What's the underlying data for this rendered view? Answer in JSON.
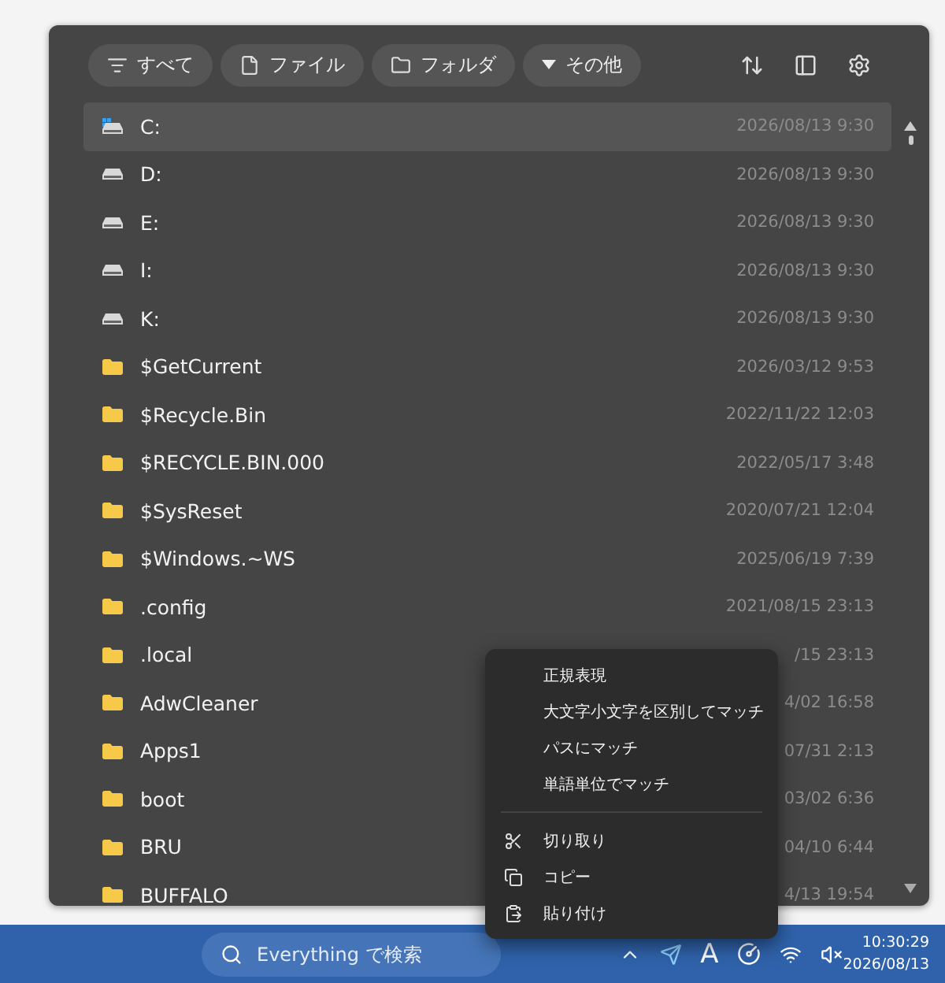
{
  "filters": [
    {
      "label": "すべて",
      "kind": "all"
    },
    {
      "label": "ファイル",
      "kind": "file"
    },
    {
      "label": "フォルダ",
      "kind": "folder"
    },
    {
      "label": "その他",
      "kind": "more"
    }
  ],
  "rows": [
    {
      "kind": "system_drive",
      "name": "C:",
      "date": "2026/08/13 9:30",
      "selected": true
    },
    {
      "kind": "drive",
      "name": "D:",
      "date": "2026/08/13 9:30",
      "selected": false
    },
    {
      "kind": "drive",
      "name": "E:",
      "date": "2026/08/13 9:30",
      "selected": false
    },
    {
      "kind": "drive",
      "name": "I:",
      "date": "2026/08/13 9:30",
      "selected": false
    },
    {
      "kind": "drive",
      "name": "K:",
      "date": "2026/08/13 9:30",
      "selected": false
    },
    {
      "kind": "folder",
      "name": "$GetCurrent",
      "date": "2026/03/12 9:53",
      "selected": false
    },
    {
      "kind": "folder",
      "name": "$Recycle.Bin",
      "date": "2022/11/22 12:03",
      "selected": false
    },
    {
      "kind": "folder",
      "name": "$RECYCLE.BIN.000",
      "date": "2022/05/17 3:48",
      "selected": false
    },
    {
      "kind": "folder",
      "name": "$SysReset",
      "date": "2020/07/21 12:04",
      "selected": false
    },
    {
      "kind": "folder",
      "name": "$Windows.~WS",
      "date": "2025/06/19 7:39",
      "selected": false
    },
    {
      "kind": "folder",
      "name": ".config",
      "date": "2021/08/15 23:13",
      "selected": false
    },
    {
      "kind": "folder",
      "name": ".local",
      "date": "/15 23:13",
      "selected": false
    },
    {
      "kind": "folder",
      "name": "AdwCleaner",
      "date": "4/02 16:58",
      "selected": false
    },
    {
      "kind": "folder",
      "name": "Apps1",
      "date": "07/31 2:13",
      "selected": false
    },
    {
      "kind": "folder",
      "name": "boot",
      "date": "03/02 6:36",
      "selected": false
    },
    {
      "kind": "folder",
      "name": "BRU",
      "date": "04/10 6:44",
      "selected": false
    },
    {
      "kind": "folder",
      "name": "BUFFALO",
      "date": "4/13 19:54",
      "selected": false
    }
  ],
  "context_menu": [
    {
      "kind": "option",
      "label": "正規表現"
    },
    {
      "kind": "option",
      "label": "大文字小文字を区別してマッチ"
    },
    {
      "kind": "option",
      "label": "パスにマッチ"
    },
    {
      "kind": "option",
      "label": "単語単位でマッチ"
    },
    {
      "kind": "separator"
    },
    {
      "kind": "cut",
      "label": "切り取り"
    },
    {
      "kind": "copy",
      "label": "コピー"
    },
    {
      "kind": "paste",
      "label": "貼り付け"
    }
  ],
  "taskbar": {
    "search_placeholder": "Everything で検索",
    "tray_letter": "A",
    "time": "10:30:29",
    "date": "2026/08/13"
  }
}
